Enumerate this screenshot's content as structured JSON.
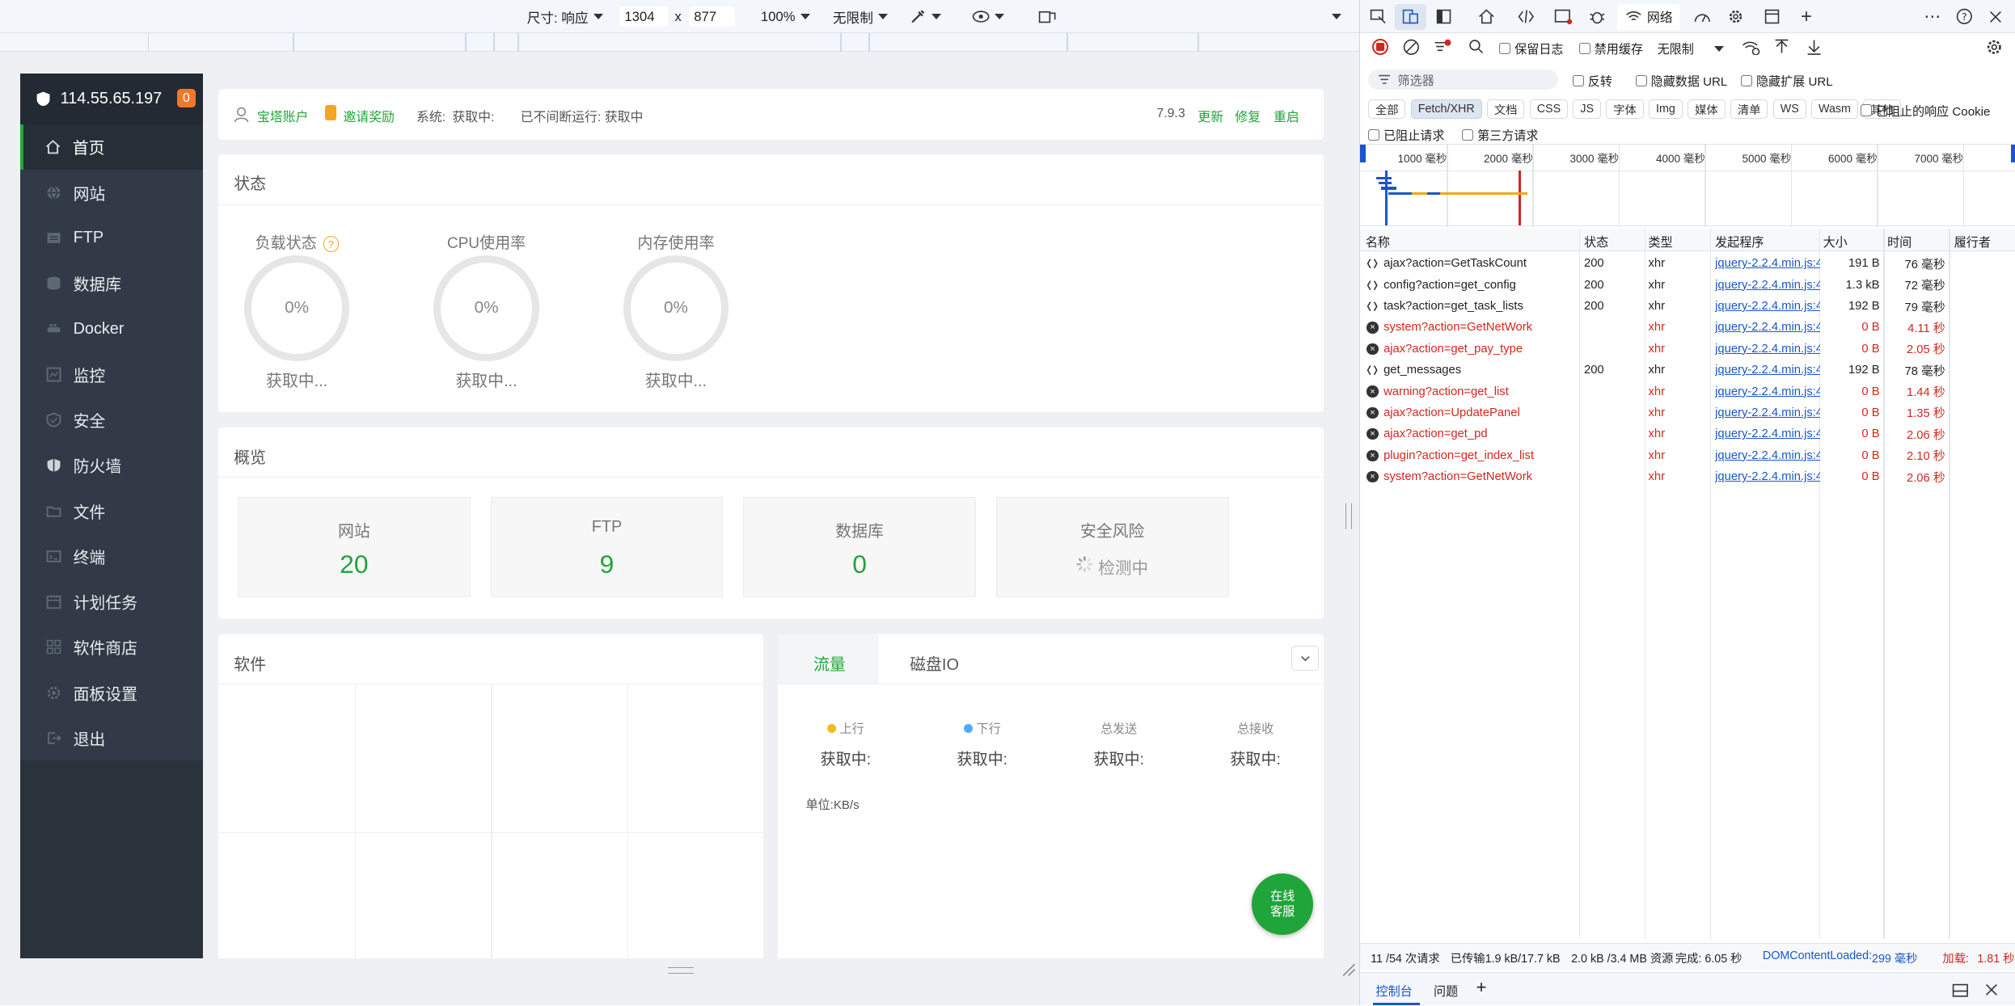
{
  "device_toolbar": {
    "dimensions_label": "尺寸: 响应",
    "width": "1304",
    "x_sep": "x",
    "height": "877",
    "zoom": "100%",
    "throttle": "无限制"
  },
  "sidebar": {
    "ip": "114.55.65.197",
    "badge": "0",
    "items": [
      {
        "label": "首页",
        "icon": "home-icon"
      },
      {
        "label": "网站",
        "icon": "globe-icon"
      },
      {
        "label": "FTP",
        "icon": "ftp-icon"
      },
      {
        "label": "数据库",
        "icon": "database-icon"
      },
      {
        "label": "Docker",
        "icon": "docker-icon"
      },
      {
        "label": "监控",
        "icon": "monitor-icon"
      },
      {
        "label": "安全",
        "icon": "shield-check-icon"
      },
      {
        "label": "防火墙",
        "icon": "firewall-icon"
      },
      {
        "label": "文件",
        "icon": "folder-icon"
      },
      {
        "label": "终端",
        "icon": "terminal-icon"
      },
      {
        "label": "计划任务",
        "icon": "calendar-icon"
      },
      {
        "label": "软件商店",
        "icon": "grid-icon"
      },
      {
        "label": "面板设置",
        "icon": "gear-icon"
      },
      {
        "label": "退出",
        "icon": "logout-icon"
      }
    ]
  },
  "topbar": {
    "account": "宝塔账户",
    "invite": "邀请奖励",
    "system_label": "系统:",
    "system_value": "获取中:",
    "uptime": "已不间断运行: 获取中",
    "version": "7.9.3",
    "update": "更新",
    "repair": "修复",
    "restart": "重启"
  },
  "status": {
    "title": "状态",
    "gauges": [
      {
        "label": "负载状态",
        "value": "0%",
        "state": "获取中..."
      },
      {
        "label": "CPU使用率",
        "value": "0%",
        "state": "获取中..."
      },
      {
        "label": "内存使用率",
        "value": "0%",
        "state": "获取中..."
      }
    ],
    "help_glyph": "?"
  },
  "overview": {
    "title": "概览",
    "boxes": [
      {
        "label": "网站",
        "value": "20"
      },
      {
        "label": "FTP",
        "value": "9"
      },
      {
        "label": "数据库",
        "value": "0"
      },
      {
        "label": "安全风险",
        "value": "检测中"
      }
    ]
  },
  "software": {
    "title": "软件"
  },
  "traffic": {
    "tabs": [
      "流量",
      "磁盘IO"
    ],
    "cols": [
      {
        "label": "上行",
        "value": "获取中:",
        "dot": "#f7b924"
      },
      {
        "label": "下行",
        "value": "获取中:",
        "dot": "#52a9ff"
      },
      {
        "label": "总发送",
        "value": "获取中:"
      },
      {
        "label": "总接收",
        "value": "获取中:"
      }
    ],
    "unit": "单位:KB/s"
  },
  "chat_button": {
    "line1": "在线",
    "line2": "客服"
  },
  "devtools": {
    "network_tab": "网络",
    "preserve_log": "保留日志",
    "disable_cache": "禁用缓存",
    "throttle": "无限制",
    "filter_placeholder": "筛选器",
    "invert": "反转",
    "hide_data_url": "隐藏数据 URL",
    "hide_ext_url": "隐藏扩展 URL",
    "types": [
      "全部",
      "Fetch/XHR",
      "文档",
      "CSS",
      "JS",
      "字体",
      "Img",
      "媒体",
      "清单",
      "WS",
      "Wasm",
      "其他"
    ],
    "blocked_cookies": "已阻止的响应 Cookie",
    "blocked_requests": "已阻止请求",
    "third_party": "第三方请求",
    "timeline_ticks": [
      "1000 毫秒",
      "2000 毫秒",
      "3000 毫秒",
      "4000 毫秒",
      "5000 毫秒",
      "6000 毫秒",
      "7000 毫秒"
    ],
    "columns": [
      "名称",
      "状态",
      "类型",
      "发起程序",
      "大小",
      "时间",
      "履行者"
    ],
    "requests": [
      {
        "name": "ajax?action=GetTaskCount",
        "status": "200",
        "type": "xhr",
        "initiator": "jquery-2.2.4.min.js:4",
        "size": "191 B",
        "time": "76 毫秒",
        "error": false
      },
      {
        "name": "config?action=get_config",
        "status": "200",
        "type": "xhr",
        "initiator": "jquery-2.2.4.min.js:4",
        "size": "1.3 kB",
        "time": "72 毫秒",
        "error": false
      },
      {
        "name": "task?action=get_task_lists",
        "status": "200",
        "type": "xhr",
        "initiator": "jquery-2.2.4.min.js:4",
        "size": "192 B",
        "time": "79 毫秒",
        "error": false
      },
      {
        "name": "system?action=GetNetWork",
        "status": "",
        "type": "xhr",
        "initiator": "jquery-2.2.4.min.js:4",
        "size": "0 B",
        "time": "4.11 秒",
        "error": true
      },
      {
        "name": "ajax?action=get_pay_type",
        "status": "",
        "type": "xhr",
        "initiator": "jquery-2.2.4.min.js:4",
        "size": "0 B",
        "time": "2.05 秒",
        "error": true
      },
      {
        "name": "get_messages",
        "status": "200",
        "type": "xhr",
        "initiator": "jquery-2.2.4.min.js:4",
        "size": "192 B",
        "time": "78 毫秒",
        "error": false
      },
      {
        "name": "warning?action=get_list",
        "status": "",
        "type": "xhr",
        "initiator": "jquery-2.2.4.min.js:4",
        "size": "0 B",
        "time": "1.44 秒",
        "error": true
      },
      {
        "name": "ajax?action=UpdatePanel",
        "status": "",
        "type": "xhr",
        "initiator": "jquery-2.2.4.min.js:4",
        "size": "0 B",
        "time": "1.35 秒",
        "error": true
      },
      {
        "name": "ajax?action=get_pd",
        "status": "",
        "type": "xhr",
        "initiator": "jquery-2.2.4.min.js:4",
        "size": "0 B",
        "time": "2.06 秒",
        "error": true
      },
      {
        "name": "plugin?action=get_index_list",
        "status": "",
        "type": "xhr",
        "initiator": "jquery-2.2.4.min.js:4",
        "size": "0 B",
        "time": "2.10 秒",
        "error": true
      },
      {
        "name": "system?action=GetNetWork",
        "status": "",
        "type": "xhr",
        "initiator": "jquery-2.2.4.min.js:4",
        "size": "0 B",
        "time": "2.06 秒",
        "error": true
      }
    ],
    "footer": {
      "requests": "11 /54 次请求",
      "transferred": "已传输1.9 kB/17.7 kB",
      "resources": "2.0 kB /3.4 MB 资源",
      "finish": "完成: 6.05 秒",
      "dcl_label": "DOMContentLoaded:",
      "dcl_value": "299 毫秒",
      "load_label": "加载:",
      "load_value": "1.81 秒"
    },
    "drawer_tabs": [
      "控制台",
      "问题"
    ]
  },
  "colors": {
    "brand": "#20a53a",
    "sidebar": "#313a46",
    "error": "#d1271f",
    "link": "#1a56c9"
  }
}
